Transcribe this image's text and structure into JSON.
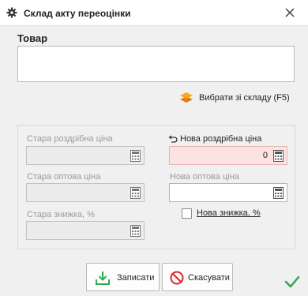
{
  "window": {
    "title": "Склад акту переоцінки",
    "icon": "gear-icon",
    "close": "close-icon"
  },
  "product": {
    "label": "Товар",
    "value": ""
  },
  "pick_from_stock": {
    "label": "Вибрати зі складу (F5)",
    "icon": "layers-icon"
  },
  "prices": {
    "old_retail": {
      "label": "Стара роздрібна ціна",
      "value": ""
    },
    "new_retail": {
      "label": "Нова роздрібна ціна",
      "value": "0"
    },
    "old_wholesale": {
      "label": "Стара оптова ціна",
      "value": ""
    },
    "new_wholesale": {
      "label": "Нова оптова ціна",
      "value": ""
    },
    "old_discount": {
      "label": "Стара знижка, %",
      "value": ""
    },
    "new_discount": {
      "label": "Нова знижка, %",
      "checked": false
    }
  },
  "buttons": {
    "save": "Записати",
    "cancel": "Скасувати"
  },
  "colors": {
    "accent_orange": "#f39a1e",
    "save_green": "#2fa84f",
    "cancel_red": "#d9262b",
    "invalid_field": "#fde2e2"
  }
}
